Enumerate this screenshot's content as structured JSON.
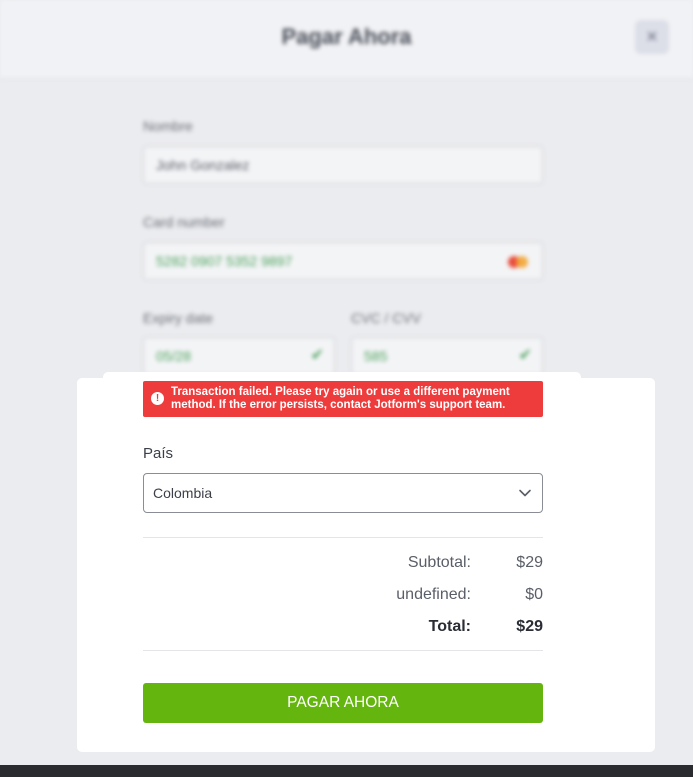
{
  "header": {
    "title": "Pagar Ahora",
    "close_glyph": "×"
  },
  "background_form": {
    "name_label": "Nombre",
    "name_value": "John Gonzalez",
    "card_label": "Card number",
    "card_value": "5282 0907 5352 9897",
    "expiry_label": "Expiry date",
    "expiry_value": "05/28",
    "cvc_label": "CVC / CVV",
    "cvc_value": "585"
  },
  "error": {
    "icon_glyph": "!",
    "message": "Transaction failed. Please try again or use a different payment method. If the error persists, contact Jotform's support team."
  },
  "country": {
    "label": "País",
    "value": "Colombia"
  },
  "summary": {
    "subtotal_label": "Subtotal:",
    "subtotal_value": "$29",
    "extra_label": "undefined:",
    "extra_value": "$0",
    "total_label": "Total:",
    "total_value": "$29"
  },
  "pay_button": {
    "label": "PAGAR AHORA"
  },
  "colors": {
    "error_bg": "#ee3b3b",
    "button_green": "#64b60f",
    "valid_green": "#4aa05a"
  },
  "icons": [
    "close-icon",
    "mastercard-icon",
    "checkmark-icon",
    "error-icon",
    "chevron-down-icon"
  ]
}
